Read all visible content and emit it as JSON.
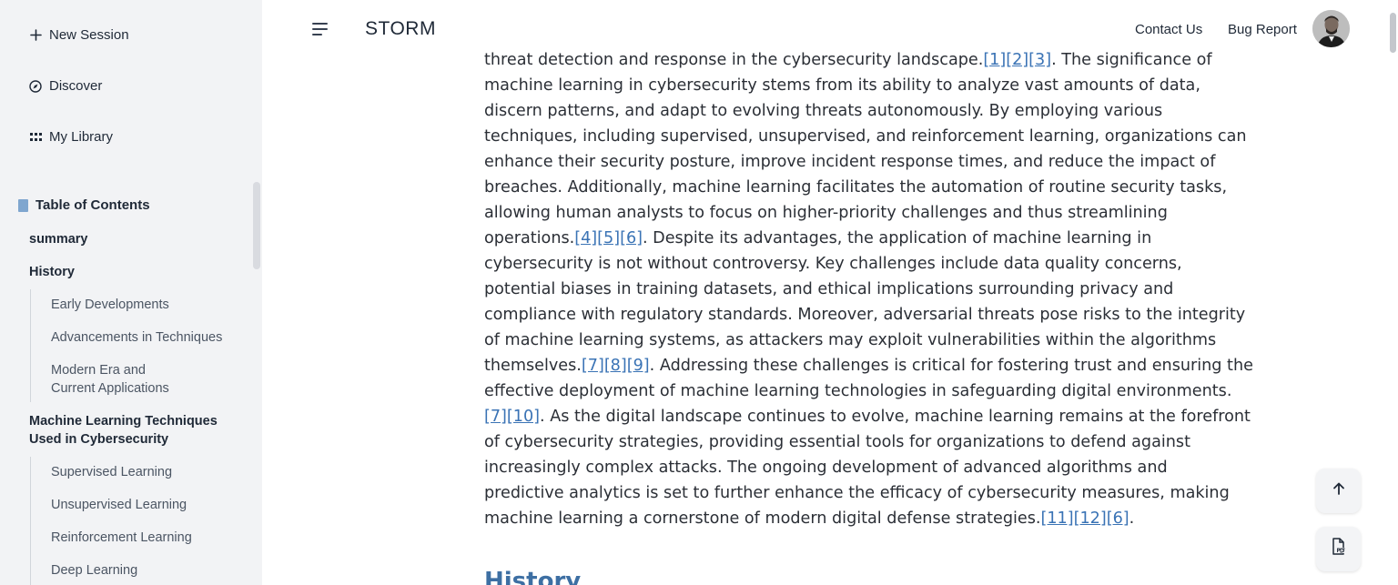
{
  "sidebar": {
    "nav": [
      {
        "label": "New Session",
        "icon": "plus-icon"
      },
      {
        "label": "Discover",
        "icon": "compass-icon"
      },
      {
        "label": "My Library",
        "icon": "grid-icon"
      }
    ],
    "toc_title": "Table of Contents",
    "toc": {
      "summary": "summary",
      "history": "History",
      "early": "Early Developments",
      "advancements": "Advancements in Techniques",
      "modern_1": "Modern Era and",
      "modern_2": "Current Applications",
      "ml_1": "Machine Learning Techniques",
      "ml_2": "Used in Cybersecurity",
      "supervised": "Supervised Learning",
      "unsupervised": "Unsupervised Learning",
      "reinforcement": "Reinforcement Learning",
      "cut": "Deep Learning"
    }
  },
  "header": {
    "brand": "STORM",
    "contact": "Contact Us",
    "bug": "Bug Report"
  },
  "article": {
    "l1a": "threat detection and response in the cybersecurity landscape.",
    "l1c": ". The significance of",
    "l2": "machine learning in cybersecurity stems from its ability to analyze vast amounts of data,",
    "l3": "discern patterns, and adapt to evolving threats autonomously. By employing various",
    "l4": "techniques, including supervised, unsupervised, and reinforcement learning, organizations can",
    "l5": "enhance their security posture, improve incident response times, and reduce the impact of",
    "l6": "breaches. Additionally, machine learning facilitates the automation of routine security tasks,",
    "l7": "allowing human analysts to focus on higher-priority challenges and thus streamlining",
    "l8a": "operations.",
    "l8c": ". Despite its advantages, the application of machine learning in",
    "l9": "cybersecurity is not without controversy. Key challenges include data quality concerns,",
    "l10": "potential biases in training datasets, and ethical implications surrounding privacy and",
    "l11": "compliance with regulatory standards. Moreover, adversarial threats pose risks to the integrity",
    "l12": "of machine learning systems, as attackers may exploit vulnerabilities within the algorithms",
    "l13a": "themselves.",
    "l13c": ". Addressing these challenges is critical for fostering trust and ensuring the",
    "l14": "effective deployment of machine learning technologies in safeguarding digital environments.",
    "l15c": ". As the digital landscape continues to evolve, machine learning remains at the forefront",
    "l16": "of cybersecurity strategies, providing essential tools for organizations to defend against",
    "l17": "increasingly complex attacks. The ongoing development of advanced algorithms and",
    "l18": "predictive analytics is set to further enhance the efficacy of cybersecurity measures, making",
    "l19a": "machine learning a cornerstone of modern digital defense strategies.",
    "l19c": ".",
    "c1": "[1]",
    "c2": "[2]",
    "c3": "[3]",
    "c4": "[4]",
    "c5": "[5]",
    "c6": "[6]",
    "c7": "[7]",
    "c8": "[8]",
    "c9": "[9]",
    "c7b": "[7]",
    "c10": "[10]",
    "c11": "[11]",
    "c12": "[12]",
    "c6b": "[6]",
    "next_section": "History"
  },
  "colors": {
    "sidebar_bg": "#f2f3f5",
    "citation": "#3a73b5",
    "section_heading": "#3d6fa3",
    "book_icon": "#7fa6cf"
  }
}
